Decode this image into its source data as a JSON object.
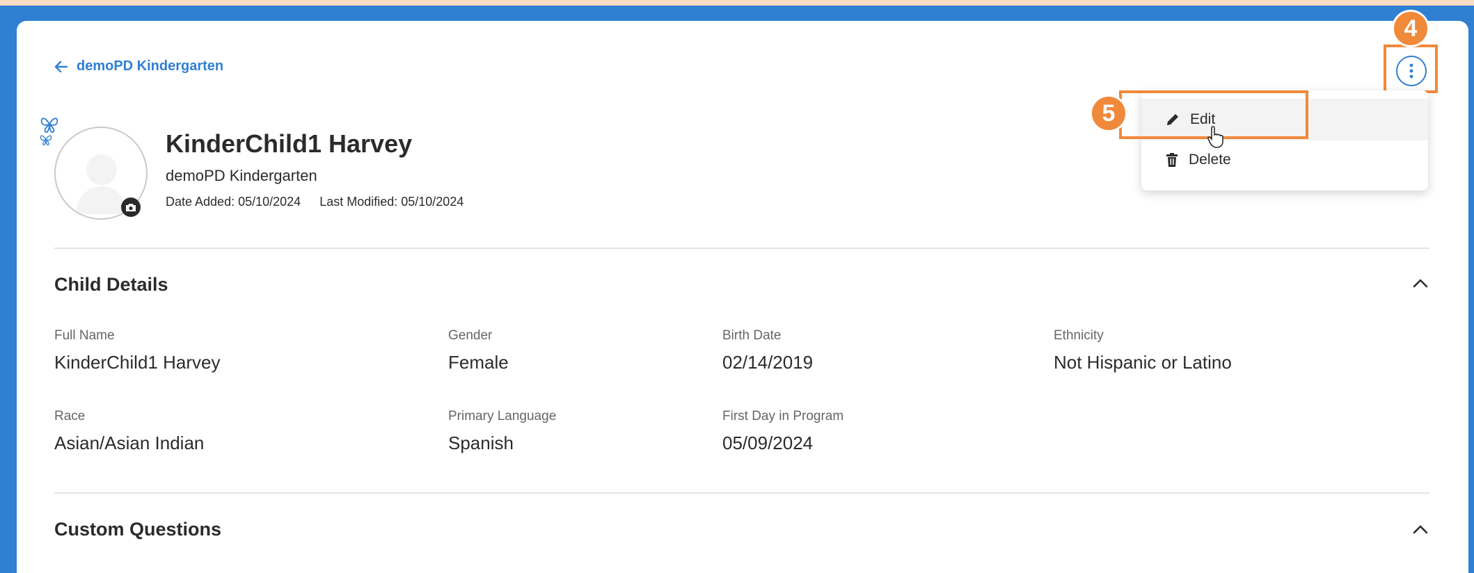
{
  "header": {
    "back_link": "demoPD Kindergarten"
  },
  "profile": {
    "name": "KinderChild1 Harvey",
    "program": "demoPD Kindergarten",
    "date_added": "Date Added: 05/10/2024",
    "last_modified": "Last Modified: 05/10/2024"
  },
  "child_details": {
    "title": "Child Details",
    "fields": [
      {
        "label": "Full Name",
        "value": "KinderChild1 Harvey"
      },
      {
        "label": "Gender",
        "value": "Female"
      },
      {
        "label": "Birth Date",
        "value": "02/14/2019"
      },
      {
        "label": "Ethnicity",
        "value": "Not Hispanic or Latino"
      },
      {
        "label": "Race",
        "value": "Asian/Asian Indian"
      },
      {
        "label": "Primary Language",
        "value": "Spanish"
      },
      {
        "label": "First Day in Program",
        "value": "05/09/2024"
      }
    ]
  },
  "custom_questions": {
    "title": "Custom Questions"
  },
  "menu": {
    "edit_label": "Edit",
    "delete_label": "Delete"
  },
  "annotations": {
    "step_4": "4",
    "step_5": "5"
  },
  "colors": {
    "accent": "#2f7fd3",
    "annotation": "#f0893a",
    "text": "#2b2b2b"
  }
}
